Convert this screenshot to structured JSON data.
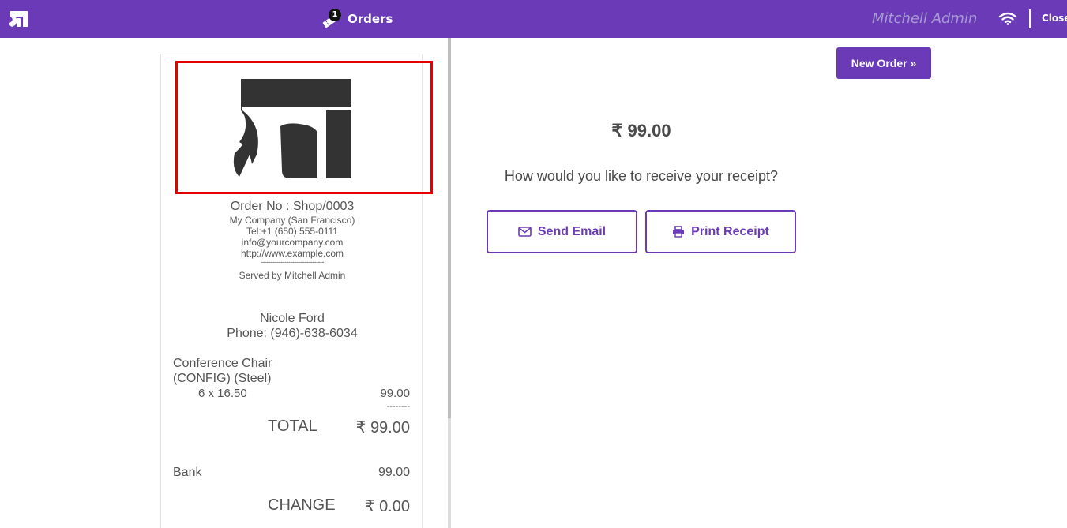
{
  "topbar": {
    "logo_icon": "odoo-logo-icon",
    "orders_badge": "1",
    "orders_label": "Orders",
    "user_name": "Mitchell Admin",
    "wifi_icon": "wifi-icon",
    "close_label": "Close"
  },
  "receipt": {
    "logo": "company-logo",
    "order_no": "Order No : Shop/0003",
    "company": "My Company (San Francisco)",
    "tel": "Tel:+1 (650) 555-0111",
    "email": "info@yourcompany.com",
    "website": "http://www.example.com",
    "separator": "--------------------------------",
    "served_by": "Served by Mitchell Admin",
    "customer_name": "Nicole Ford",
    "customer_phone": "Phone: (946)-638-6034",
    "line_name_1": "Conference Chair",
    "line_name_2": "(CONFIG) (Steel)",
    "line_qty": "6 x 16.50",
    "line_amount": "99.00",
    "line_sep": "--------",
    "total_label": "TOTAL",
    "total_value": "₹ 99.00",
    "payment_method": "Bank",
    "payment_amount": "99.00",
    "change_label": "CHANGE",
    "change_value": "₹ 0.00"
  },
  "main": {
    "new_order_label": "New Order »",
    "amount": "₹ 99.00",
    "question": "How would you like to receive your receipt?",
    "send_email_label": "Send Email",
    "print_receipt_label": "Print Receipt",
    "email_icon": "envelope-icon",
    "print_icon": "printer-icon"
  },
  "colors": {
    "brand": "#6a3ab7",
    "highlight": "#e30000"
  }
}
